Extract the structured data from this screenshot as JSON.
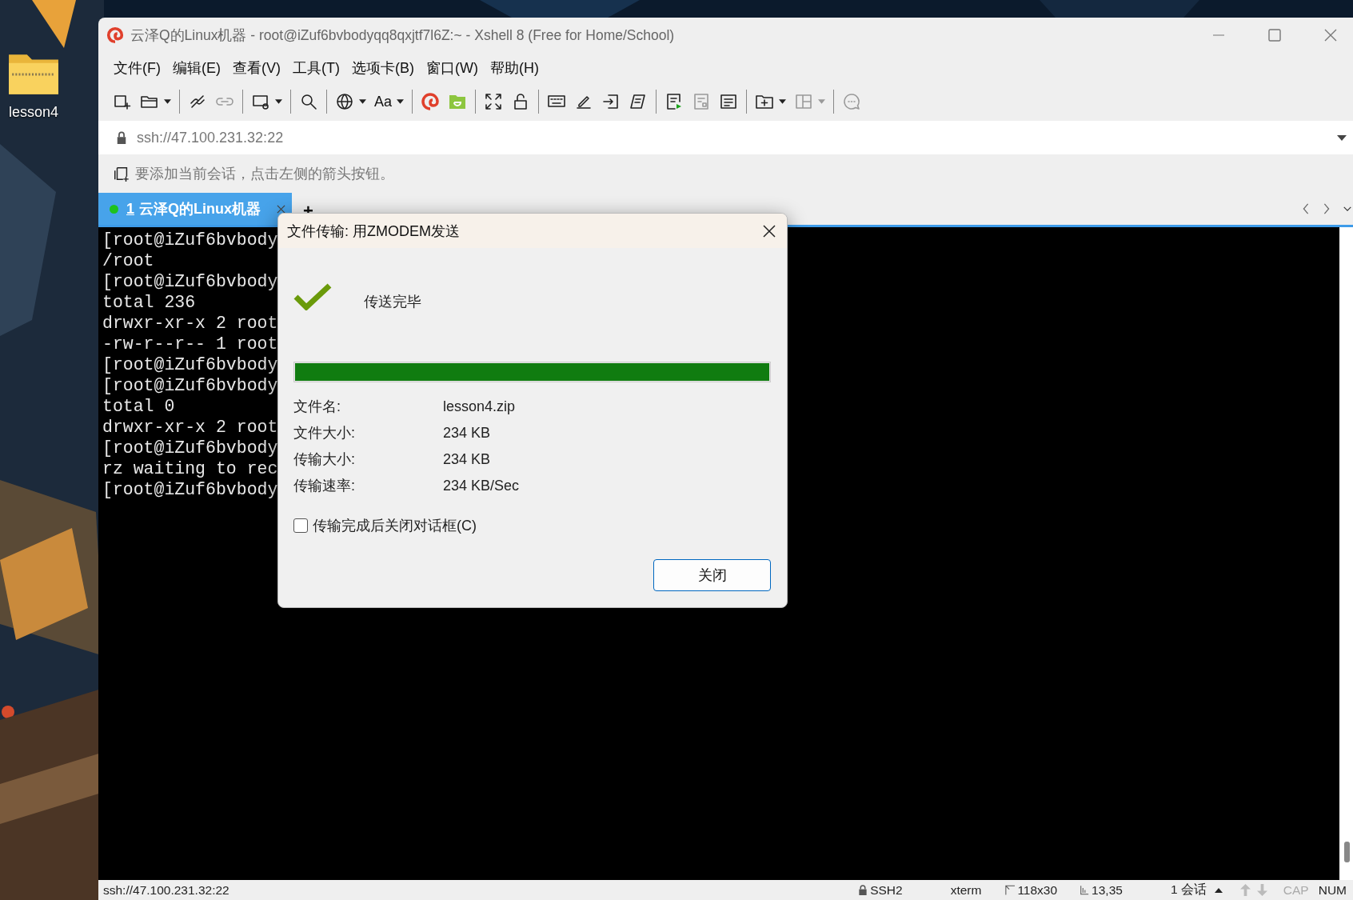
{
  "desktop": {
    "icons": [
      {
        "label": "lesson4"
      }
    ]
  },
  "window": {
    "title": "云泽Q的Linux机器 - root@iZuf6bvbodyqq8qxjtf7l6Z:~ - Xshell 8 (Free for Home/School)"
  },
  "menu": [
    "文件(F)",
    "编辑(E)",
    "查看(V)",
    "工具(T)",
    "选项卡(B)",
    "窗口(W)",
    "帮助(H)"
  ],
  "toolbar": {
    "font_label": "Aa"
  },
  "address": {
    "value": "ssh://47.100.231.32:22"
  },
  "hint": "要添加当前会话，点击左侧的箭头按钮。",
  "tabs": [
    {
      "number": "1",
      "label": "云泽Q的Linux机器",
      "selected": true,
      "connected": true
    }
  ],
  "add_tab": "+",
  "terminal": {
    "lines": [
      "[root@iZuf6bvbody",
      "/root",
      "[root@iZuf6bvbody",
      "total 236",
      "drwxr-xr-x 2 root",
      "-rw-r--r-- 1 root",
      "[root@iZuf6bvbody",
      "[root@iZuf6bvbody",
      "total 0",
      "drwxr-xr-x 2 root",
      "[root@iZuf6bvbody",
      "rz waiting to rec",
      "[root@iZuf6bvbody"
    ]
  },
  "dialog": {
    "title": "文件传输: 用ZMODEM发送",
    "status": "传送完毕",
    "progress": {
      "level": 1
    },
    "fields": [
      {
        "label": "文件名:",
        "value": "lesson4.zip"
      },
      {
        "label": "文件大小:",
        "value": "234 KB"
      },
      {
        "label": "传输大小:",
        "value": "234 KB"
      },
      {
        "label": "传输速率:",
        "value": "234 KB/Sec"
      }
    ],
    "close_on_finish": {
      "label": "传输完成后关闭对话框(C)",
      "checked": false
    },
    "button": "关闭"
  },
  "status_bar": {
    "address": "ssh://47.100.231.32:22",
    "protocol": "SSH2",
    "terminal_type": "xterm",
    "size": "118x30",
    "cursor": "13,35",
    "sessions": "1 会话",
    "indicators": [
      {
        "label": "CAP",
        "on": false
      },
      {
        "label": "NUM",
        "on": true
      }
    ]
  }
}
